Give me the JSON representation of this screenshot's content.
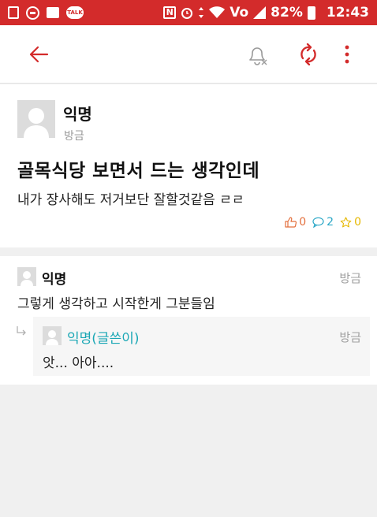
{
  "status_bar": {
    "battery": "82%",
    "time": "12:43",
    "network": "Vo",
    "talk_label": "TALK",
    "nfc_label": "N"
  },
  "toolbar": {
    "icons": [
      "back-arrow-icon",
      "bell-off-icon",
      "refresh-icon",
      "more-icon"
    ],
    "accent_color": "#d32b2b"
  },
  "post": {
    "author": "익명",
    "time": "방금",
    "title": "골목식당 보면서 드는 생각인데",
    "body": "내가 장사해도 저거보단 잘할것같음 ㄹㄹ",
    "likes": "0",
    "comments": "2",
    "scraps": "0"
  },
  "comments": [
    {
      "author": "익명",
      "time": "방금",
      "text": "그렇게 생각하고 시작한게 그분들임",
      "reply": {
        "author": "익명(글쓴이)",
        "time": "방금",
        "text": "앗... 아아...."
      }
    }
  ]
}
